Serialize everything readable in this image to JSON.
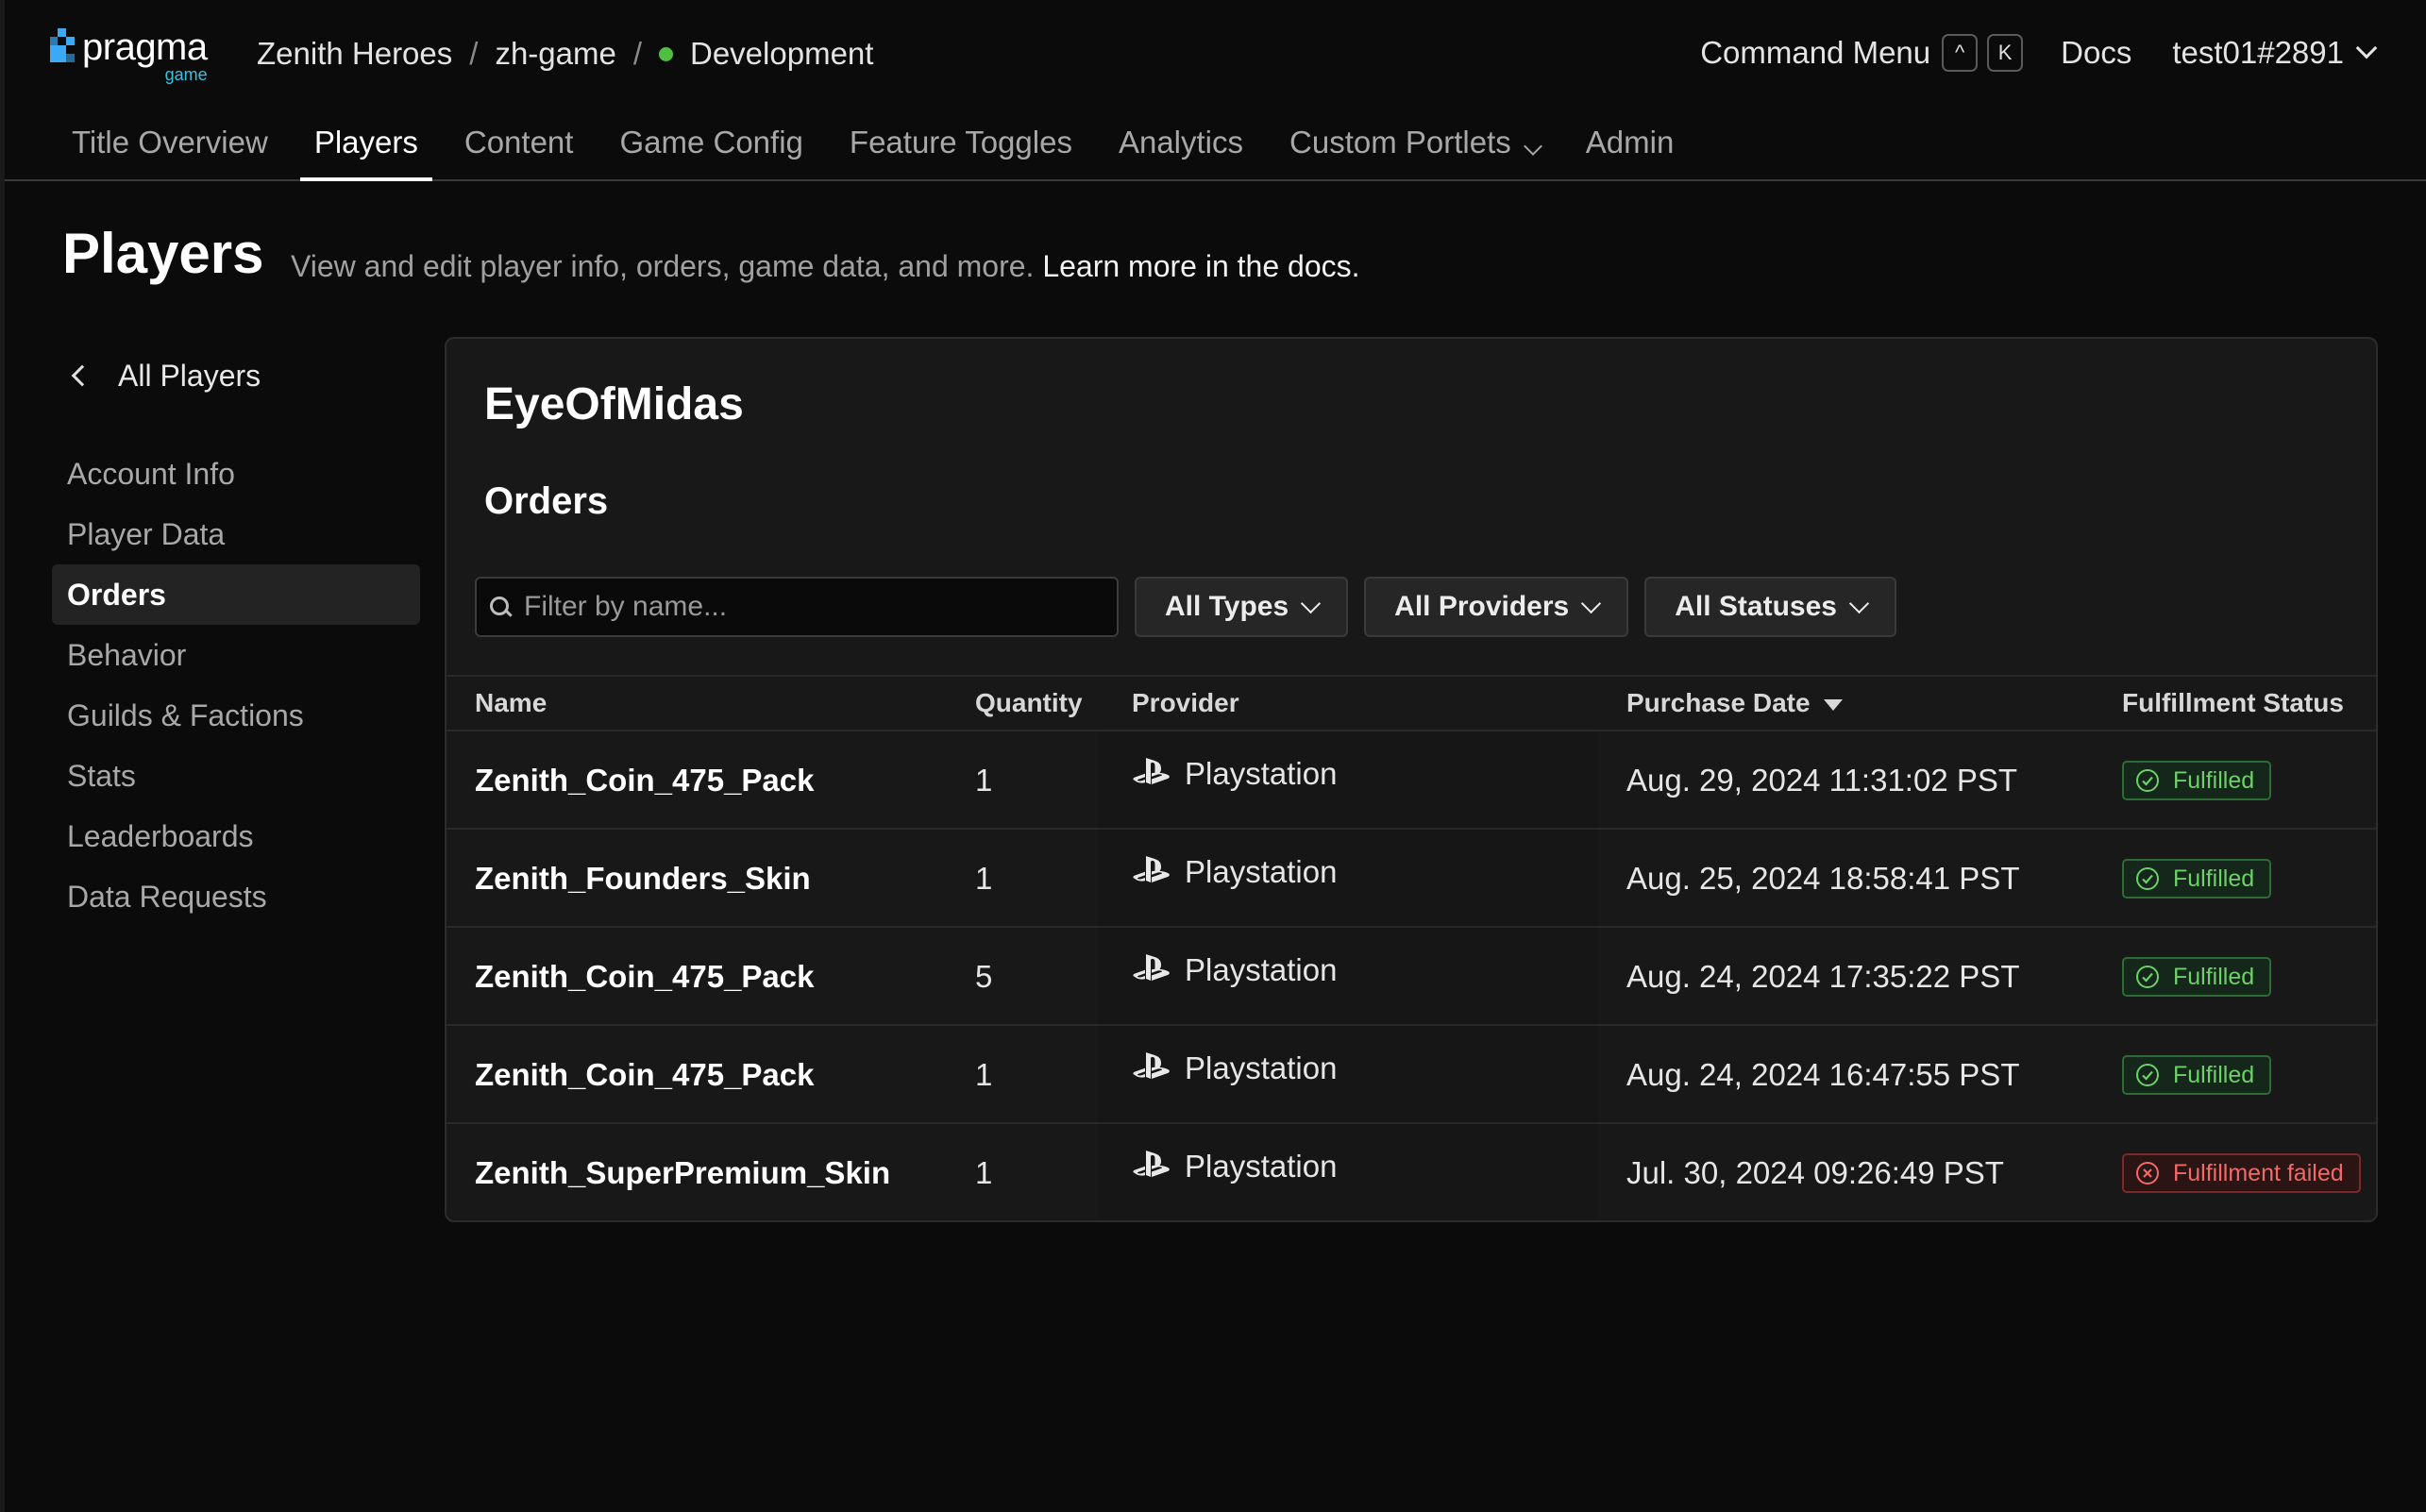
{
  "header": {
    "logo_word": "pragma",
    "logo_sub": "game",
    "breadcrumbs": [
      "Zenith Heroes",
      "zh-game",
      "Development"
    ],
    "env_status_color": "#4fbf43",
    "command_menu_label": "Command Menu",
    "command_menu_keys": [
      "^",
      "K"
    ],
    "docs_label": "Docs",
    "user_label": "test01#2891"
  },
  "tabs": [
    {
      "label": "Title Overview"
    },
    {
      "label": "Players",
      "active": true
    },
    {
      "label": "Content"
    },
    {
      "label": "Game Config"
    },
    {
      "label": "Feature Toggles"
    },
    {
      "label": "Analytics"
    },
    {
      "label": "Custom Portlets",
      "has_dropdown": true
    },
    {
      "label": "Admin"
    }
  ],
  "page": {
    "title": "Players",
    "description": "View and edit player info, orders, game data, and more.",
    "docs_link": "Learn more in the docs."
  },
  "sidebar": {
    "back_label": "All Players",
    "items": [
      {
        "label": "Account Info"
      },
      {
        "label": "Player Data"
      },
      {
        "label": "Orders",
        "active": true
      },
      {
        "label": "Behavior"
      },
      {
        "label": "Guilds & Factions"
      },
      {
        "label": "Stats"
      },
      {
        "label": "Leaderboards"
      },
      {
        "label": "Data Requests"
      }
    ]
  },
  "main": {
    "player_name": "EyeOfMidas",
    "section_title": "Orders",
    "search": {
      "placeholder": "Filter by name...",
      "value": ""
    },
    "filters": {
      "types": "All Types",
      "providers": "All Providers",
      "statuses": "All Statuses"
    },
    "table": {
      "columns": {
        "name": "Name",
        "quantity": "Quantity",
        "provider": "Provider",
        "purchase_date": "Purchase Date",
        "status": "Fulfillment Status"
      },
      "sorted_by": "Purchase Date",
      "sort_direction": "descending",
      "rows": [
        {
          "name": "Zenith_Coin_475_Pack",
          "quantity": "1",
          "provider": "Playstation",
          "purchase_date": "Aug. 29, 2024 11:31:02 PST",
          "status": "Fulfilled",
          "status_kind": "ok"
        },
        {
          "name": "Zenith_Founders_Skin",
          "quantity": "1",
          "provider": "Playstation",
          "purchase_date": "Aug. 25, 2024 18:58:41 PST",
          "status": "Fulfilled",
          "status_kind": "ok"
        },
        {
          "name": "Zenith_Coin_475_Pack",
          "quantity": "5",
          "provider": "Playstation",
          "purchase_date": "Aug. 24, 2024 17:35:22 PST",
          "status": "Fulfilled",
          "status_kind": "ok"
        },
        {
          "name": "Zenith_Coin_475_Pack",
          "quantity": "1",
          "provider": "Playstation",
          "purchase_date": "Aug. 24, 2024 16:47:55 PST",
          "status": "Fulfilled",
          "status_kind": "ok"
        },
        {
          "name": "Zenith_SuperPremium_Skin",
          "quantity": "1",
          "provider": "Playstation",
          "purchase_date": "Jul. 30, 2024 09:26:49 PST",
          "status": "Fulfillment failed",
          "status_kind": "fail"
        }
      ]
    }
  },
  "icons": {
    "provider": "playstation-icon",
    "ok": "check-circle-icon",
    "fail": "x-circle-icon",
    "search": "search-icon"
  },
  "colors": {
    "accent_logo": "#3ba9f5",
    "success": "#6fcf6a",
    "error": "#f06a6a"
  }
}
